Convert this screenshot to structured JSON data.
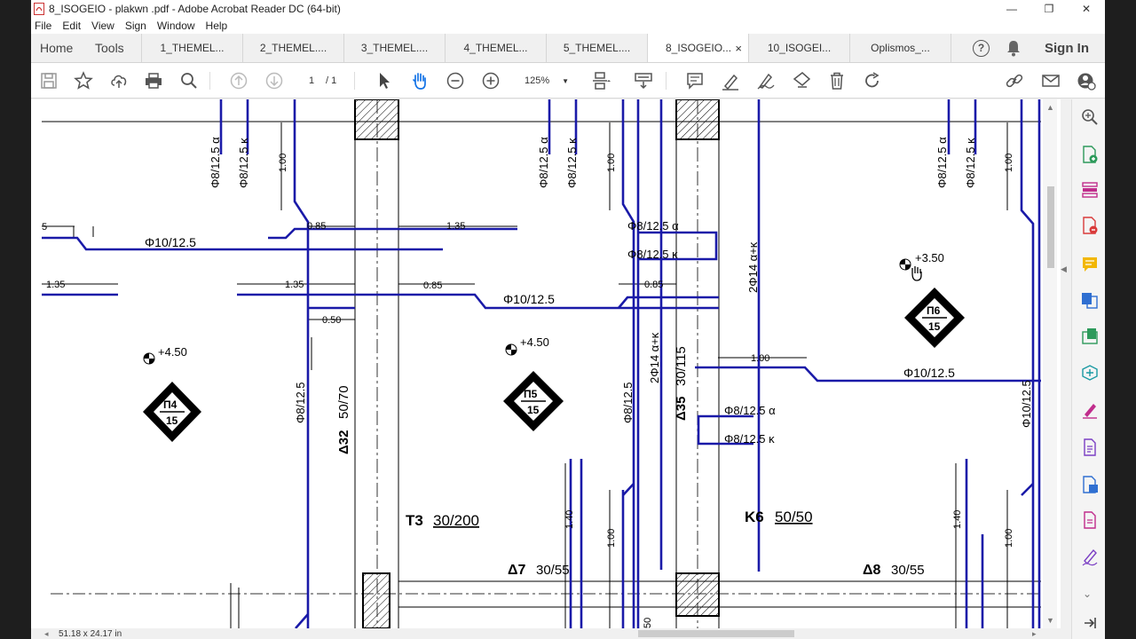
{
  "window": {
    "title": "8_ISOGEIO - plakwn .pdf - Adobe Acrobat Reader DC (64-bit)",
    "minimize": "—",
    "restore": "❐",
    "close": "✕"
  },
  "menu": [
    "File",
    "Edit",
    "View",
    "Sign",
    "Window",
    "Help"
  ],
  "tabs": {
    "home": "Home",
    "tools": "Tools",
    "docs": [
      "1_THEMEL...",
      "2_THEMEL....",
      "3_THEMEL....",
      "4_THEMEL...",
      "5_THEMEL....",
      "8_ISOGEIO...",
      "10_ISOGEI...",
      "Oplismos_..."
    ],
    "active_index": 5,
    "close_glyph": "×",
    "help": "?",
    "sign_in": "Sign In"
  },
  "toolbar": {
    "page_current": "1",
    "page_total": "/ 1",
    "zoom": "125%"
  },
  "status": {
    "page_size": "51.18 x 24.17 in"
  },
  "drawing": {
    "labels": {
      "f8a_1": "Φ8/12.5 α",
      "f8k_1": "Φ8/12.5 κ",
      "d100_1": "1.00",
      "f8a_2": "Φ8/12.5 α",
      "f8k_2": "Φ8/12.5 κ",
      "d100_2": "1.00",
      "f8a_3": "Φ8/12.5 α",
      "f8k_3": "Φ8/12.5 κ",
      "d100_3": "1.00",
      "d5": "5",
      "f10_top": "Φ10/12.5",
      "d085_1": "0.85",
      "d135_1": "1.35",
      "f8a_h": "Φ8/12.5 α",
      "f8k_h": "Φ8/12.5 κ",
      "f14ak_1": "2Φ14 α+κ",
      "elev_350": "+3.50",
      "p6_top": "Π6",
      "p6_bot": "15",
      "d135_2": "1.35",
      "d135_3": "1.35",
      "d085_2": "0.85",
      "d085_3": "0.85",
      "f10_mid": "Φ10/12.5",
      "d050": "0.50",
      "elev_450_1": "+4.50",
      "p4_top": "Π4",
      "p4_bot": "15",
      "elev_450_2": "+4.50",
      "p5_top": "Π5",
      "p5_bot": "15",
      "f8_12_1": "Φ8/12.5",
      "d32": "Δ32",
      "d32_dim": "50/70",
      "f8_12_2": "Φ8/12.5",
      "f14ak_2": "2Φ14 α+κ",
      "d35": "Δ35",
      "d35_dim": "30/115",
      "d100_mid": "1.00",
      "f10_right": "Φ10/12.5",
      "f10_12_edge": "Φ10/12.5",
      "f8a_4": "Φ8/12.5 α",
      "f8k_4": "Φ8/12.5 κ",
      "t3": "Τ3",
      "t3_dim": "30/200",
      "k6": "Κ6",
      "k6_dim": "50/50",
      "d140_1": "1.40",
      "d100_4": "1.00",
      "d140_2": "1.40",
      "d100_5": "1.00",
      "d7": "Δ7",
      "d7_dim": "30/55",
      "d8": "Δ8",
      "d8_dim": "30/55",
      "d50_bot": "50"
    }
  }
}
